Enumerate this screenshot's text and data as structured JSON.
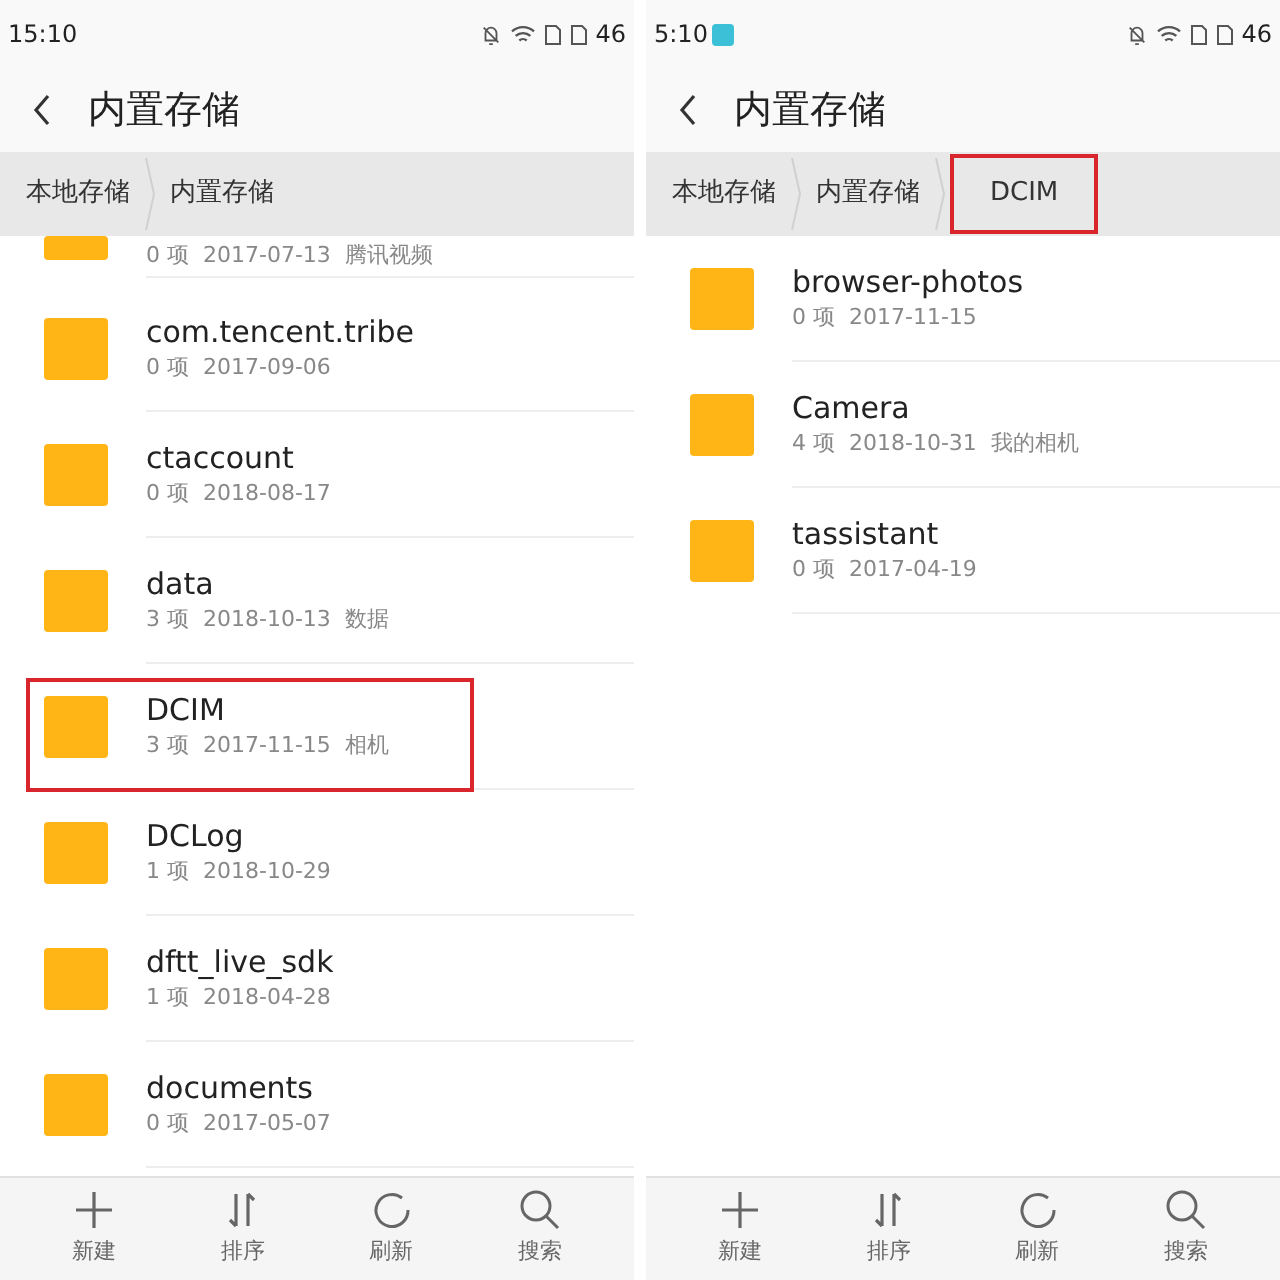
{
  "screens": [
    {
      "status_bar": {
        "time": "15:10",
        "app_badge": false,
        "battery": "46"
      },
      "title": "内置存储",
      "breadcrumbs": [
        {
          "label": "本地存储",
          "highlighted": false
        },
        {
          "label": "内置存储",
          "highlighted": false
        }
      ],
      "folders": [
        {
          "meta": "0 项  2017-07-13  腾讯视频",
          "highlighted": false
        },
        {
          "name": "com.tencent.tribe",
          "meta": "0 项  2017-09-06",
          "highlighted": false
        },
        {
          "name": "ctaccount",
          "meta": "0 项  2018-08-17",
          "highlighted": false
        },
        {
          "name": "data",
          "meta": "3 项  2018-10-13  数据",
          "highlighted": false
        },
        {
          "name": "DCIM",
          "meta": "3 项  2017-11-15  相机",
          "highlighted": true
        },
        {
          "name": "DCLog",
          "meta": "1 项  2018-10-29",
          "highlighted": false
        },
        {
          "name": "dftt_live_sdk",
          "meta": "1 项  2018-04-28",
          "highlighted": false
        },
        {
          "name": "documents",
          "meta": "0 项  2017-05-07",
          "highlighted": false
        }
      ],
      "toolbar": [
        {
          "kind": "new",
          "label": "新建"
        },
        {
          "kind": "sort",
          "label": "排序"
        },
        {
          "kind": "refresh",
          "label": "刷新"
        },
        {
          "kind": "search",
          "label": "搜索"
        }
      ]
    },
    {
      "status_bar": {
        "time": "5:10",
        "app_badge": true,
        "battery": "46"
      },
      "title": "内置存储",
      "breadcrumbs": [
        {
          "label": "本地存储",
          "highlighted": false
        },
        {
          "label": "内置存储",
          "highlighted": false
        },
        {
          "label": "DCIM",
          "highlighted": true
        }
      ],
      "folders": [
        {
          "name": "browser-photos",
          "meta": "0 项  2017-11-15",
          "highlighted": false
        },
        {
          "name": "Camera",
          "meta": "4 项  2018-10-31  我的相机",
          "highlighted": false
        },
        {
          "name": "tassistant",
          "meta": "0 项  2017-04-19",
          "highlighted": false
        }
      ],
      "toolbar": [
        {
          "kind": "new",
          "label": "新建"
        },
        {
          "kind": "sort",
          "label": "排序"
        },
        {
          "kind": "refresh",
          "label": "刷新"
        },
        {
          "kind": "search",
          "label": "搜索"
        }
      ]
    }
  ]
}
